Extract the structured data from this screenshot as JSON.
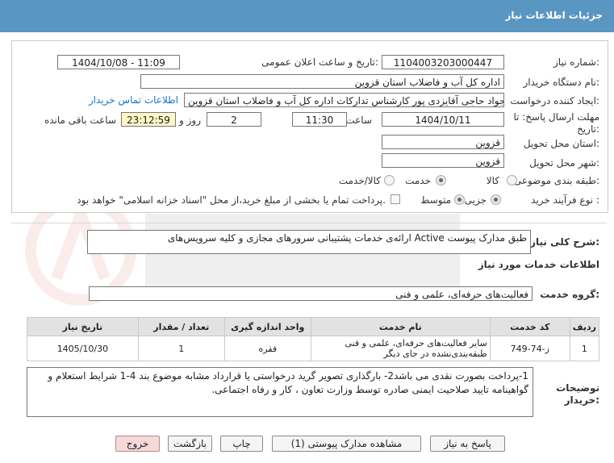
{
  "header": {
    "title": "جزئیات اطلاعات نیاز"
  },
  "form": {
    "need_number_label": "شماره نیاز:",
    "need_number": "1104003203000447",
    "announce_label": "تاریخ و ساعت اعلان عمومی:",
    "announce_value": "1404/10/08 - 11:09",
    "buyer_org_label": "نام دستگاه خریدار:",
    "buyer_org": "اداره کل آب و فاضلاب استان قزوین",
    "creator_label": "ایجاد کننده درخواست:",
    "creator": "محمدجواد حاجی آقایزدی پور کارشناس تدارکات اداره کل آب و فاضلاب استان قزوین",
    "contact_link": "اطلاعات تماس خریدار",
    "deadline_label_1": "مهلت ارسال پاسخ: تا",
    "deadline_label_2": "تاریخ:",
    "deadline_date": "1404/10/11",
    "time_label": "ساعت",
    "deadline_time": "11:30",
    "days_value": "2",
    "days_label": "روز و",
    "remaining_value": "23:12:59",
    "remaining_label": "ساعت باقی مانده",
    "province_label": "استان محل تحویل:",
    "province": "قزوین",
    "city_label": "شهر محل تحویل:",
    "city": "قزوین",
    "category_label": "طبقه بندی موضوعی:",
    "category_options": [
      "کالا",
      "خدمت",
      "کالا/خدمت"
    ],
    "category_selected": "خدمت",
    "process_label": "نوع فرآیند خرید :",
    "process_options": [
      "جزیی",
      "متوسط"
    ],
    "process_selected": "جزیی",
    "process_note": "پرداخت تمام یا بخشی از مبلغ خرید،از محل \"اسناد خزانه اسلامی\" خواهد بود."
  },
  "summary": {
    "label": "شرح کلی نیاز:",
    "text": "ارائه‌ی خدمات پشتیبانی سرورهای مجازی و کلیه سرویس‌های Active طبق مدارک پیوست"
  },
  "services": {
    "section_title": "اطلاعات خدمات مورد نیاز",
    "group_label": "گروه خدمت:",
    "group_value": "فعالیت‌های حرفه‌ای، علمی و فنی",
    "columns": [
      "ردیف",
      "کد خدمت",
      "نام خدمت",
      "واحد اندازه گیری",
      "تعداد / مقدار",
      "تاریخ نیاز"
    ],
    "rows": [
      {
        "row": "1",
        "code": "ز-74-749",
        "name": "سایر فعالیت‌های حرفه‌ای، علمی و فنی طبقه‌بندی‌نشده در جای دیگر",
        "unit": "فقره",
        "qty": "1",
        "date": "1405/10/30"
      }
    ]
  },
  "notes": {
    "label_1": "توضیحات",
    "label_2": "خریدار:",
    "text": "1-پرداخت بصورت نقدی می باشد2- بارگذاری تصویر گرید درخواستی یا قرارداد مشابه موضوع بند 4-1 شرایط استعلام و گواهینامه تایید صلاحیت ایمنی صادره توسط وزارت تعاون ، کار و رفاه اجتماعی."
  },
  "buttons": {
    "reply": "پاسخ به نیاز",
    "attachments": "مشاهده مدارک پیوستی (1)",
    "print": "چاپ",
    "back": "بازگشت",
    "exit": "خروج"
  },
  "colors": {
    "header": "#5a96c2",
    "link": "#1a73c9",
    "remaining_bg": "#fff6c6",
    "exit_bg": "#f7d9d9"
  }
}
